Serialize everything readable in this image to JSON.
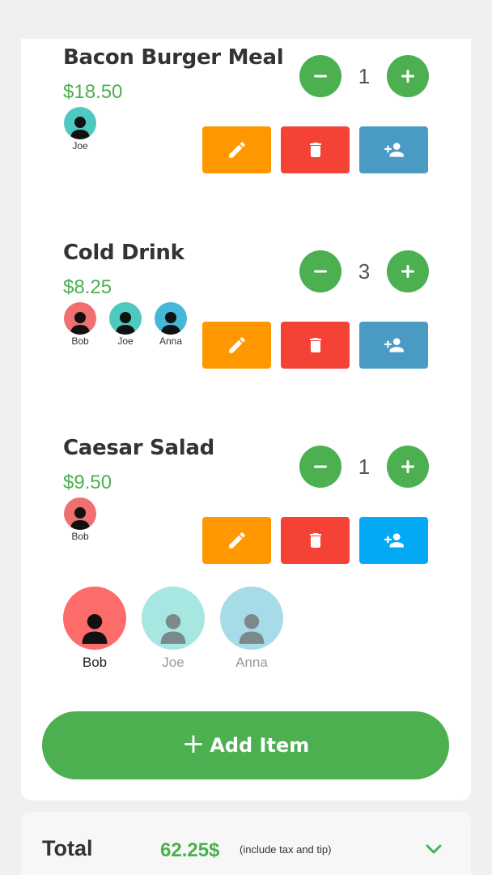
{
  "items": [
    {
      "name": "Bacon Burger Meal",
      "price": "$18.50",
      "quantity": "1",
      "people": [
        {
          "name": "Joe",
          "color": "#4dc9c0"
        }
      ]
    },
    {
      "name": "Cold Drink",
      "price": "$8.25",
      "quantity": "3",
      "people": [
        {
          "name": "Bob",
          "color": "#f07070"
        },
        {
          "name": "Joe",
          "color": "#4dc9c0"
        },
        {
          "name": "Anna",
          "color": "#44b8d6"
        }
      ]
    },
    {
      "name": "Caesar Salad",
      "price": "$9.50",
      "quantity": "1",
      "people": [
        {
          "name": "Bob",
          "color": "#f07070"
        }
      ]
    }
  ],
  "person_selector": [
    {
      "name": "Bob",
      "color": "#fd6b6b",
      "selected": true
    },
    {
      "name": "Joe",
      "color": "#a8e6e2",
      "selected": false
    },
    {
      "name": "Anna",
      "color": "#a8dbe8",
      "selected": false
    }
  ],
  "add_item": {
    "icon": "plus-icon",
    "label": "Add Item"
  },
  "total": {
    "label": "Total",
    "amount": "62.25$",
    "note": "(include tax and tip)",
    "icon": "chevron-down-icon"
  },
  "colors": {
    "green": "#4caf50",
    "edit": "#ff9800",
    "delete": "#f44336",
    "assign": "#4a9bc4",
    "assign_active": "#03a9f4"
  }
}
